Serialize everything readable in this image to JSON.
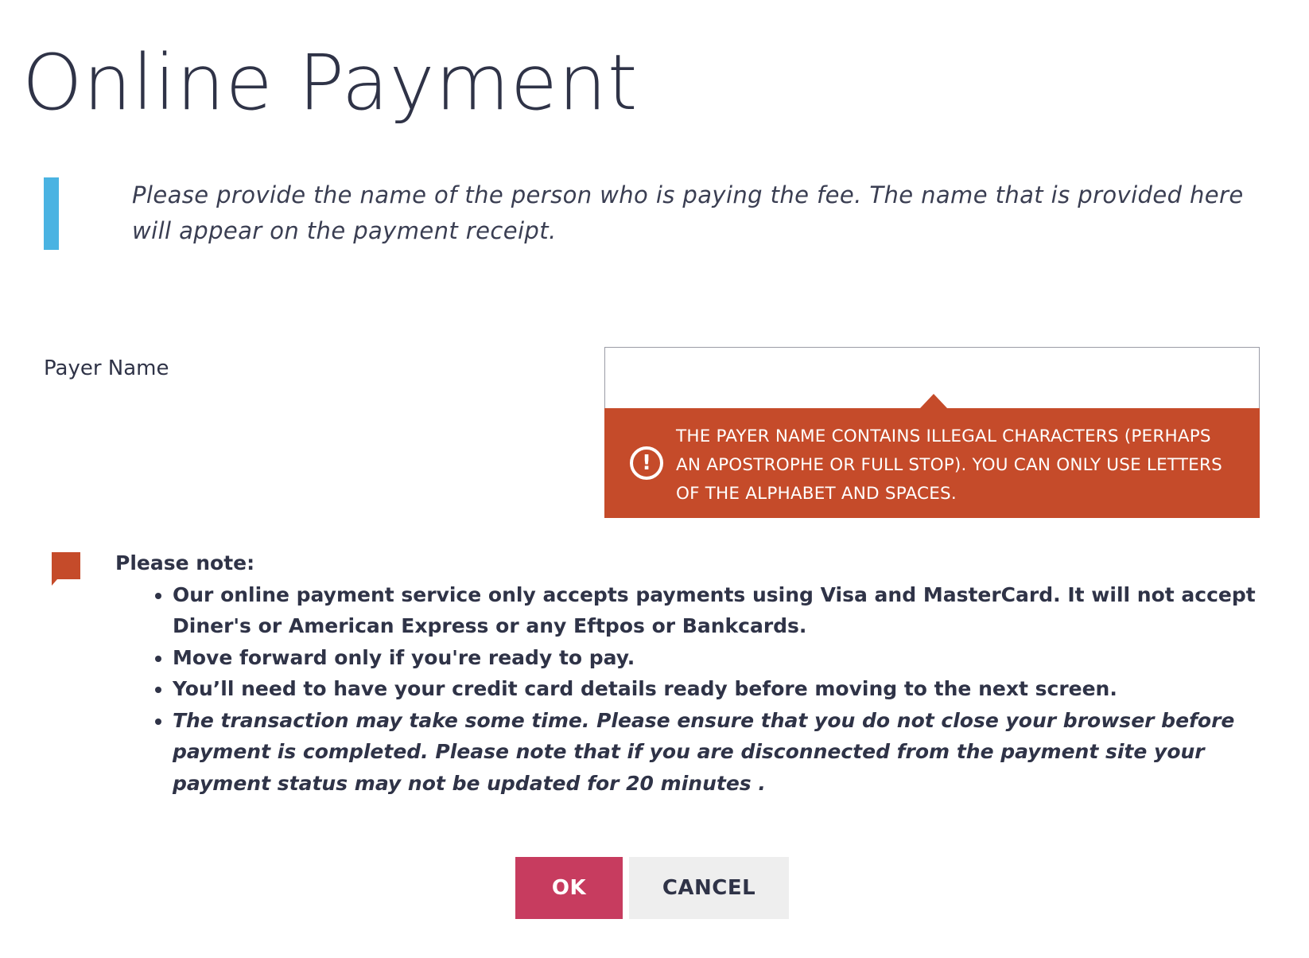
{
  "page": {
    "title": "Online Payment",
    "intro_text": "Please provide the name of the person who is paying the fee. The name that is provided here will appear on the payment receipt."
  },
  "form": {
    "payer_label": "Payer Name",
    "payer_value": "",
    "error_icon": "exclamation-circle-icon",
    "error_message": "THE PAYER NAME CONTAINS ILLEGAL CHARACTERS (PERHAPS AN APOSTROPHE OR FULL STOP). YOU CAN ONLY USE LETTERS OF THE ALPHABET AND SPACES."
  },
  "note": {
    "icon": "speech-bubble-icon",
    "title": "Please note:",
    "items": [
      "Our online payment service only accepts payments using Visa and MasterCard. It will not accept Diner's or American Express or any Eftpos or Bankcards.",
      "Move forward only if you're ready to pay.",
      "You’ll need to have your credit card details ready before moving to the next screen.",
      "The transaction may take some time. Please ensure that you do not close your browser before payment is completed. Please note that if you are disconnected from the payment site your payment status may not be updated for 20 minutes ."
    ]
  },
  "actions": {
    "ok_label": "OK",
    "cancel_label": "CANCEL"
  },
  "colors": {
    "info_accent": "#4ab3e2",
    "error_bg": "#c54b2a",
    "ok_button": "#c73c5f",
    "cancel_button": "#eeeeee",
    "text": "#2f3347"
  }
}
